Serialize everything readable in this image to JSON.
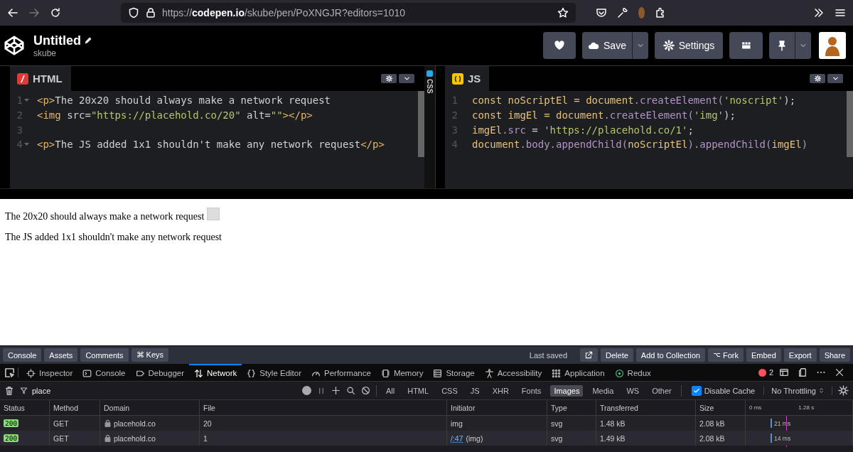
{
  "browser": {
    "url": "https://**codepen.io**/skube/pen/PoXNGJR?editors=1010"
  },
  "header": {
    "title": "Untitled",
    "user": "skube",
    "save": "Save",
    "settings": "Settings"
  },
  "editors": [
    {
      "kind": "html",
      "title": "HTML",
      "lines": [
        {
          "number": "1",
          "fold": true,
          "tokens": [
            {
              "kind": "tag",
              "text": "<p>"
            },
            {
              "kind": "text",
              "text": "The 20x20 should always make a network request"
            }
          ]
        },
        {
          "number": "2",
          "fold": false,
          "tokens": [
            {
              "kind": "tag",
              "text": "<img"
            },
            {
              "kind": "text",
              "text": " src="
            },
            {
              "kind": "str",
              "text": "\"https://placehold.co/20\""
            },
            {
              "kind": "text",
              "text": " alt="
            },
            {
              "kind": "str",
              "text": "\"\""
            },
            {
              "kind": "tag",
              "text": "></p>"
            }
          ]
        },
        {
          "number": "3",
          "fold": false
        },
        {
          "number": "4",
          "fold": true,
          "tokens": [
            {
              "kind": "tag",
              "text": "<p>"
            },
            {
              "kind": "text",
              "text": "The JS added 1x1 shouldn't make any network request"
            },
            {
              "kind": "tag",
              "text": "</p>"
            }
          ]
        }
      ]
    },
    {
      "kind": "js",
      "title": "JS",
      "lines": [
        {
          "number": "1",
          "fold": false,
          "tokens": [
            {
              "kind": "kw",
              "text": "const noScriptEl = document"
            },
            {
              "kind": "prop",
              "text": ".createElement("
            },
            {
              "kind": "str",
              "text": "'noscript'"
            },
            {
              "kind": "text",
              "text": ");"
            }
          ]
        },
        {
          "number": "2",
          "fold": false,
          "tokens": [
            {
              "kind": "kw",
              "text": "const imgEl = document"
            },
            {
              "kind": "prop",
              "text": ".createElement("
            },
            {
              "kind": "str",
              "text": "'img'"
            },
            {
              "kind": "text",
              "text": ");"
            }
          ]
        },
        {
          "number": "3",
          "fold": false,
          "tokens": [
            {
              "kind": "kw",
              "text": "imgEl"
            },
            {
              "kind": "prop",
              "text": ".src"
            },
            {
              "kind": "text",
              "text": " = "
            },
            {
              "kind": "str",
              "text": "'https://placehold.co/1'"
            },
            {
              "kind": "text",
              "text": ";"
            }
          ]
        },
        {
          "number": "4",
          "fold": false,
          "tokens": [
            {
              "kind": "kw",
              "text": "document"
            },
            {
              "kind": "prop",
              "text": ".body.appendChild("
            },
            {
              "kind": "kw",
              "text": "noScriptEl"
            },
            {
              "kind": "prop",
              "text": ").appendChild("
            },
            {
              "kind": "kw",
              "text": "imgEl"
            },
            {
              "kind": "prop",
              "text": ")"
            }
          ]
        }
      ]
    }
  ],
  "collapsed_editor": "CSS",
  "preview": {
    "paragraphs": [
      {
        "text": "The 20x20 should always make a network request",
        "image": true
      },
      {
        "text": "The JS added 1x1 shouldn't make any network request",
        "image": false
      }
    ]
  },
  "footer": {
    "left": [
      "Console",
      "Assets",
      "Comments",
      "⌘ Keys"
    ],
    "last_saved": "Last saved",
    "right": [
      "Delete",
      "Add to Collection",
      "Fork",
      "Embed",
      "Export",
      "Share"
    ]
  },
  "devtools": {
    "tabs": [
      {
        "label": "Inspector",
        "selected": false
      },
      {
        "label": "Console",
        "selected": false
      },
      {
        "label": "Debugger",
        "selected": false
      },
      {
        "label": "Network",
        "selected": true
      },
      {
        "label": "Style Editor",
        "selected": false
      },
      {
        "label": "Performance",
        "selected": false
      },
      {
        "label": "Memory",
        "selected": false
      },
      {
        "label": "Storage",
        "selected": false
      },
      {
        "label": "Accessibility",
        "selected": false
      },
      {
        "label": "Application",
        "selected": false
      },
      {
        "label": "Redux",
        "selected": false
      }
    ],
    "error_count": "2",
    "filter": {
      "value": "place"
    },
    "types": [
      {
        "label": "All",
        "selected": false
      },
      {
        "label": "HTML",
        "selected": false
      },
      {
        "label": "CSS",
        "selected": false
      },
      {
        "label": "JS",
        "selected": false
      },
      {
        "label": "XHR",
        "selected": false
      },
      {
        "label": "Fonts",
        "selected": false
      },
      {
        "label": "Images",
        "selected": true
      },
      {
        "label": "Media",
        "selected": false
      },
      {
        "label": "WS",
        "selected": false
      },
      {
        "label": "Other",
        "selected": false
      }
    ],
    "disable_cache": {
      "label": "Disable Cache",
      "checked": true
    },
    "throttling": "No Throttling",
    "columns": [
      "Status",
      "Method",
      "Domain",
      "File",
      "Initiator",
      "Type",
      "Transferred",
      "Size"
    ],
    "timeline_ticks": [
      "0 ms",
      "1.28 s"
    ],
    "rows": [
      {
        "status": "200",
        "method": "GET",
        "domain": "placehold.co",
        "file": "20",
        "initiator": "img",
        "type": "svg",
        "transferred": "1.48 kB",
        "size": "2.08 kB",
        "timing": "21 ms"
      },
      {
        "status": "200",
        "method": "GET",
        "domain": "placehold.co",
        "file": "1",
        "initiator_link": "/:47",
        "initiator": "(img)",
        "type": "svg",
        "transferred": "1.49 kB",
        "size": "2.08 kB",
        "timing": "14 ms"
      }
    ]
  }
}
